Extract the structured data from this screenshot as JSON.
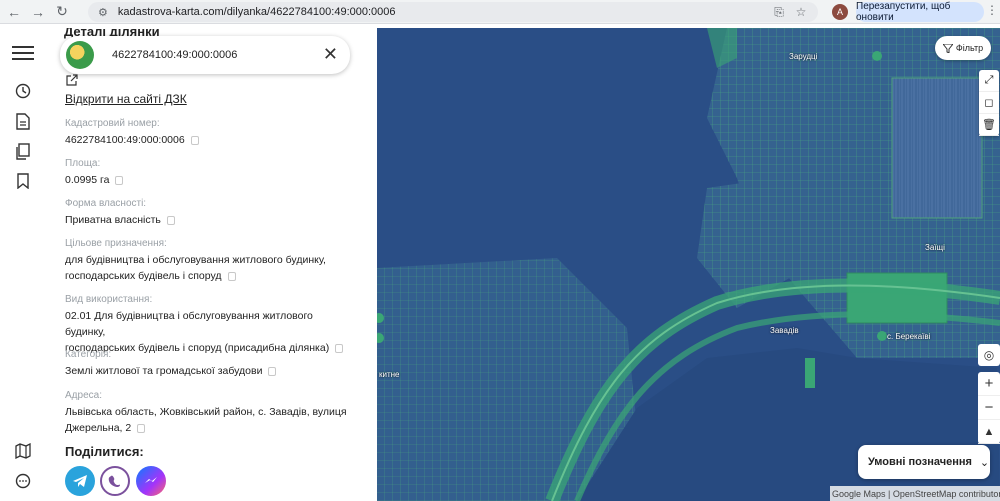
{
  "browser": {
    "url": "kadastrova-karta.com/dilyanka/4622784100:49:000:0006",
    "avatar_letter": "A",
    "restart_label": "Перезапустити, щоб оновити"
  },
  "panel": {
    "title": "Деталі ділянки",
    "search_value": "4622784100:49:000:0006",
    "dzk_link": "Відкрити на сайті ДЗК",
    "fields": {
      "cadastral_label": "Кадастровий номер:",
      "cadastral_value": "4622784100:49:000:0006",
      "area_label": "Площа:",
      "area_value": "0.0995 га",
      "ownership_label": "Форма власності:",
      "ownership_value": "Приватна власність",
      "purpose_label": "Цільове призначення:",
      "purpose_value_1": "для будівництва і обслуговування житлового будинку,",
      "purpose_value_2": "господарських будівель і споруд",
      "usage_label": "Вид використання:",
      "usage_value_1": "02.01 Для будівництва і обслуговування житлового будинку,",
      "usage_value_2": "господарських будівель і споруд (присадибна ділянка)",
      "category_label": "Категорія:",
      "category_value": "Землі житлової та громадської забудови",
      "address_label": "Адреса:",
      "address_value_1": "Львівська область, Жовківський район, с. Завадів, вулиця",
      "address_value_2": "Джерельна, 2"
    },
    "share_title": "Поділитися:"
  },
  "map": {
    "filter_label": "Фільтр",
    "legend_label": "Умовні позначення",
    "attribution": "Google Maps | OpenStreetMap contributors",
    "labels": {
      "zarudtsi": "Зарудці",
      "zaishchi": "Заїщі",
      "zavadiv": "Завадів",
      "berekaivi": "с. Берекаїві",
      "kytne": "китне"
    }
  },
  "colors": {
    "accent": "#4285f4",
    "map_blue": "#2a4e86",
    "parcel_green": "#3aa675",
    "telegram": "#2aa3dc",
    "viber": "#7b519d",
    "messenger": "#0a7cff"
  }
}
